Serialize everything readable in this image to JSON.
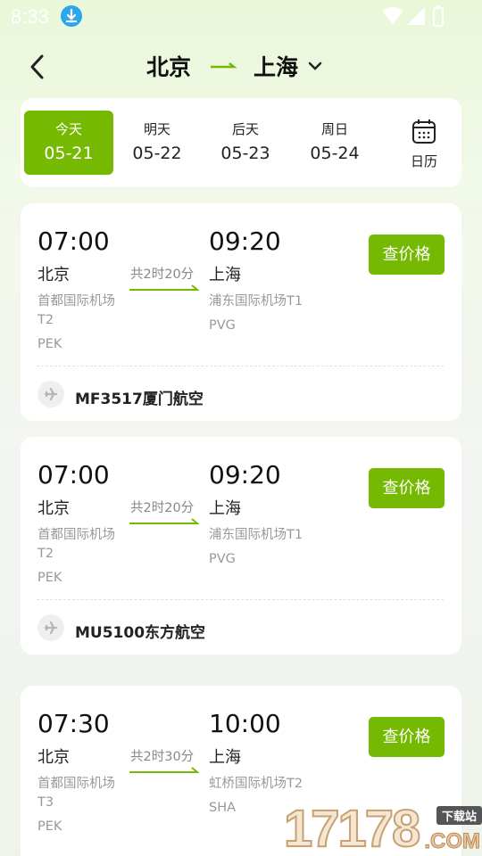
{
  "status_bar": {
    "time": "8:33",
    "download_icon": "download-icon"
  },
  "header": {
    "from_city": "北京",
    "to_city": "上海",
    "back_icon": "back-arrow-icon",
    "dropdown_icon": "chevron-down-icon"
  },
  "dates": [
    {
      "label": "今天",
      "value": "05-21",
      "selected": true
    },
    {
      "label": "明天",
      "value": "05-22",
      "selected": false
    },
    {
      "label": "后天",
      "value": "05-23",
      "selected": false
    },
    {
      "label": "周日",
      "value": "05-24",
      "selected": false
    }
  ],
  "calendar": {
    "label": "日历",
    "icon": "calendar-icon"
  },
  "price_button_label": "查价格",
  "flights": [
    {
      "dep_time": "07:00",
      "dep_city": "北京",
      "dep_airport_line1": "首都国际机场",
      "dep_airport_line2": "T2",
      "dep_code": "PEK",
      "arr_time": "09:20",
      "arr_city": "上海",
      "arr_airport": "浦东国际机场T1",
      "arr_code": "PVG",
      "duration": "共2时20分",
      "flight": "MF3517厦门航空"
    },
    {
      "dep_time": "07:00",
      "dep_city": "北京",
      "dep_airport_line1": "首都国际机场",
      "dep_airport_line2": "T2",
      "dep_code": "PEK",
      "arr_time": "09:20",
      "arr_city": "上海",
      "arr_airport": "浦东国际机场T1",
      "arr_code": "PVG",
      "duration": "共2时20分",
      "flight": "MU5100东方航空"
    },
    {
      "dep_time": "07:30",
      "dep_city": "北京",
      "dep_airport_line1": "首都国际机场",
      "dep_airport_line2": "T3",
      "dep_code": "PEK",
      "arr_time": "10:00",
      "arr_city": "上海",
      "arr_airport": "虹桥国际机场T2",
      "arr_code": "SHA",
      "duration": "共2时30分",
      "flight": ""
    }
  ],
  "watermark": {
    "digits": "17178",
    "tag": "下载站",
    "suffix": ".COM"
  },
  "colors": {
    "accent": "#76b903",
    "muted": "#999999",
    "background_tint": "#eaf7d8"
  }
}
